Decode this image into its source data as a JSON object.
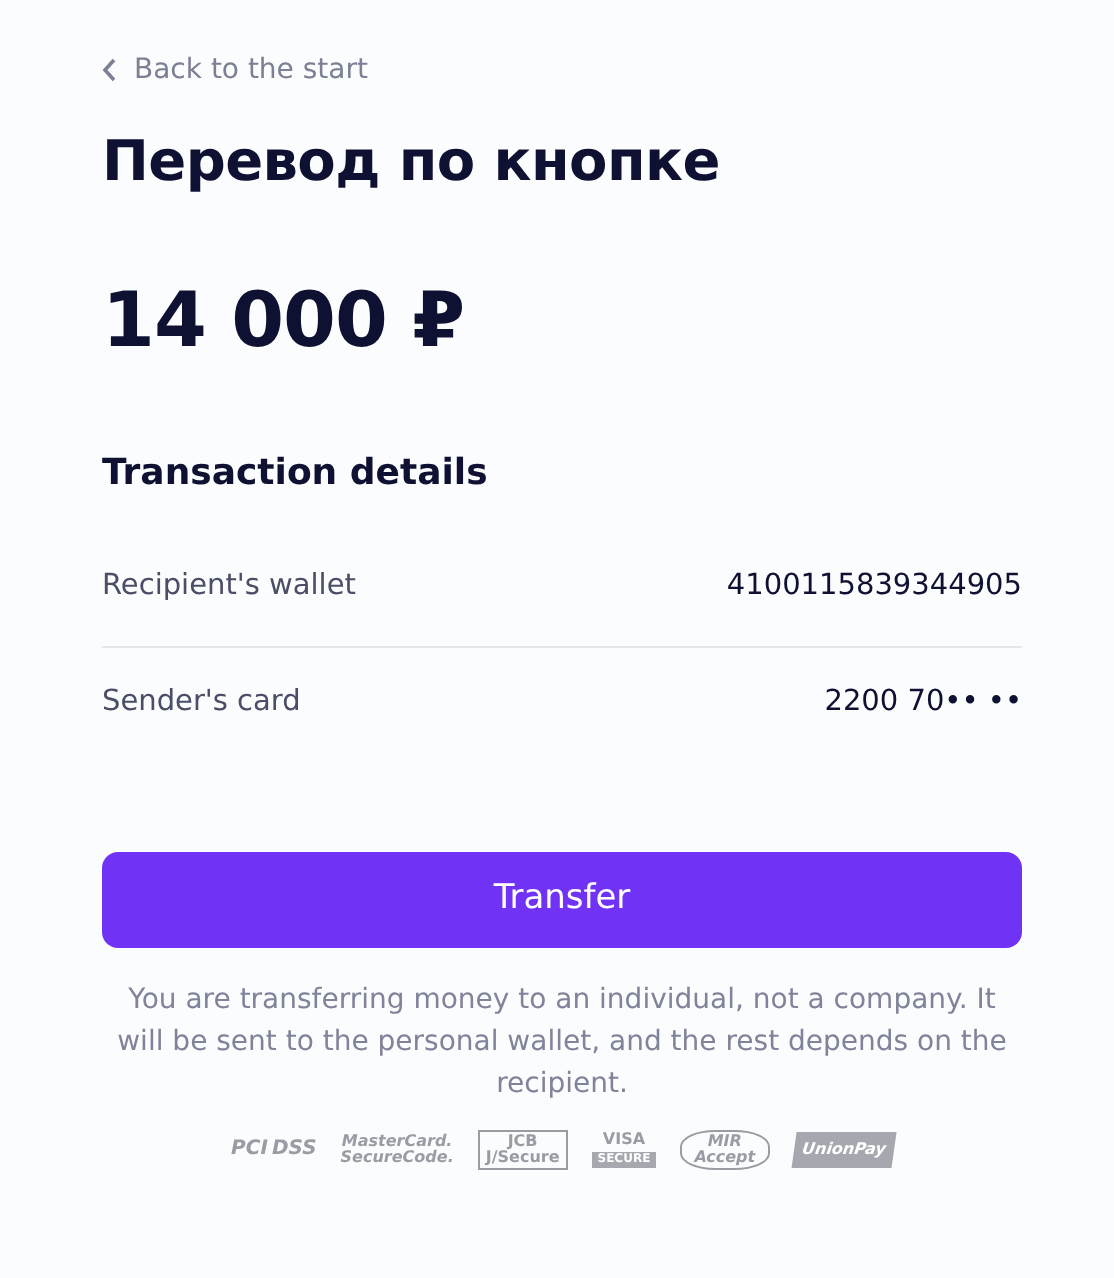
{
  "back_link": {
    "label": "Back to the start"
  },
  "title": "Перевод по кнопке",
  "amount": "14 000 ₽",
  "details": {
    "heading": "Transaction details",
    "rows": [
      {
        "label": "Recipient's wallet",
        "value": "4100115839344905"
      },
      {
        "label": "Sender's card",
        "value": "2200 70•• ••"
      }
    ]
  },
  "button": {
    "label": "Transfer"
  },
  "note": "You are transferring money to an individual, not a company. It will be sent to the personal wallet, and the rest depends on the recipient.",
  "security_badges": [
    {
      "kind": "pci",
      "lines": [
        "PCI",
        "DSS"
      ]
    },
    {
      "kind": "plain",
      "lines": [
        "MasterCard.",
        "SecureCode."
      ]
    },
    {
      "kind": "boxed",
      "lines": [
        "JCB",
        "J/Secure"
      ]
    },
    {
      "kind": "stacked",
      "lines": [
        "VISA",
        "SECURE"
      ]
    },
    {
      "kind": "oval",
      "lines": [
        "MIR",
        "Accept"
      ]
    },
    {
      "kind": "slanted",
      "lines": [
        "UnionPay"
      ]
    }
  ]
}
